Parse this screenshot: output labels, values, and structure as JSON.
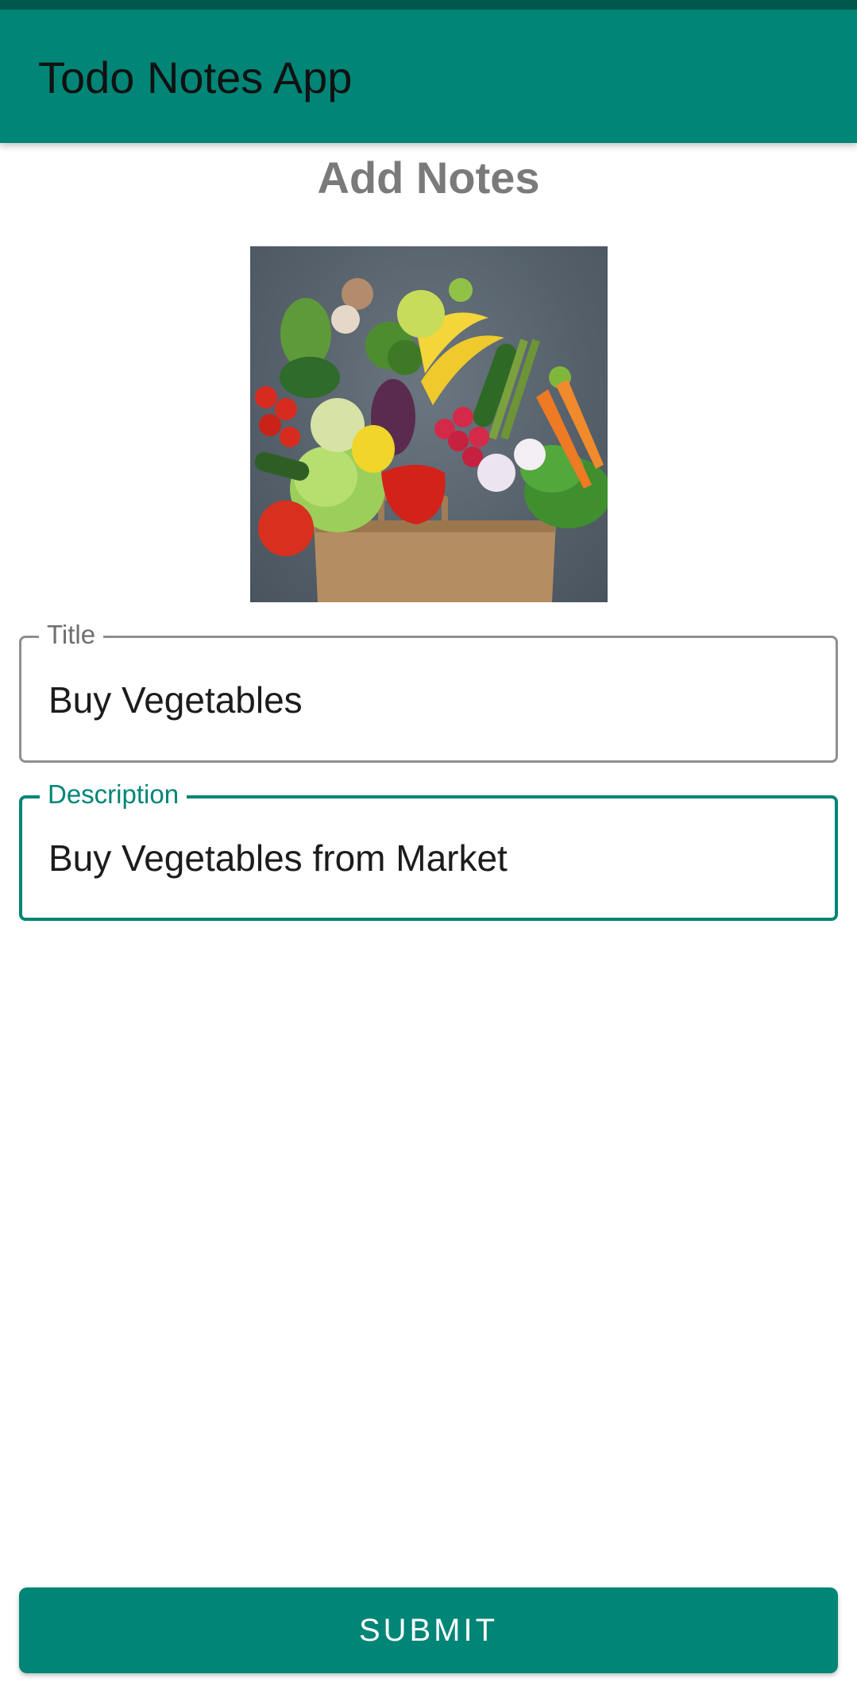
{
  "app_bar": {
    "title": "Todo Notes App"
  },
  "page": {
    "heading": "Add Notes"
  },
  "image": {
    "name": "vegetables-grocery-bag-image"
  },
  "form": {
    "title_field": {
      "label": "Title",
      "value": "Buy Vegetables"
    },
    "description_field": {
      "label": "Description",
      "value": "Buy Vegetables from Market"
    },
    "submit_label": "SUBMIT"
  },
  "colors": {
    "primary": "#008577",
    "primary_dark": "#00574b",
    "heading_gray": "#7a7a7a",
    "field_border_inactive": "#8f8f8f"
  }
}
